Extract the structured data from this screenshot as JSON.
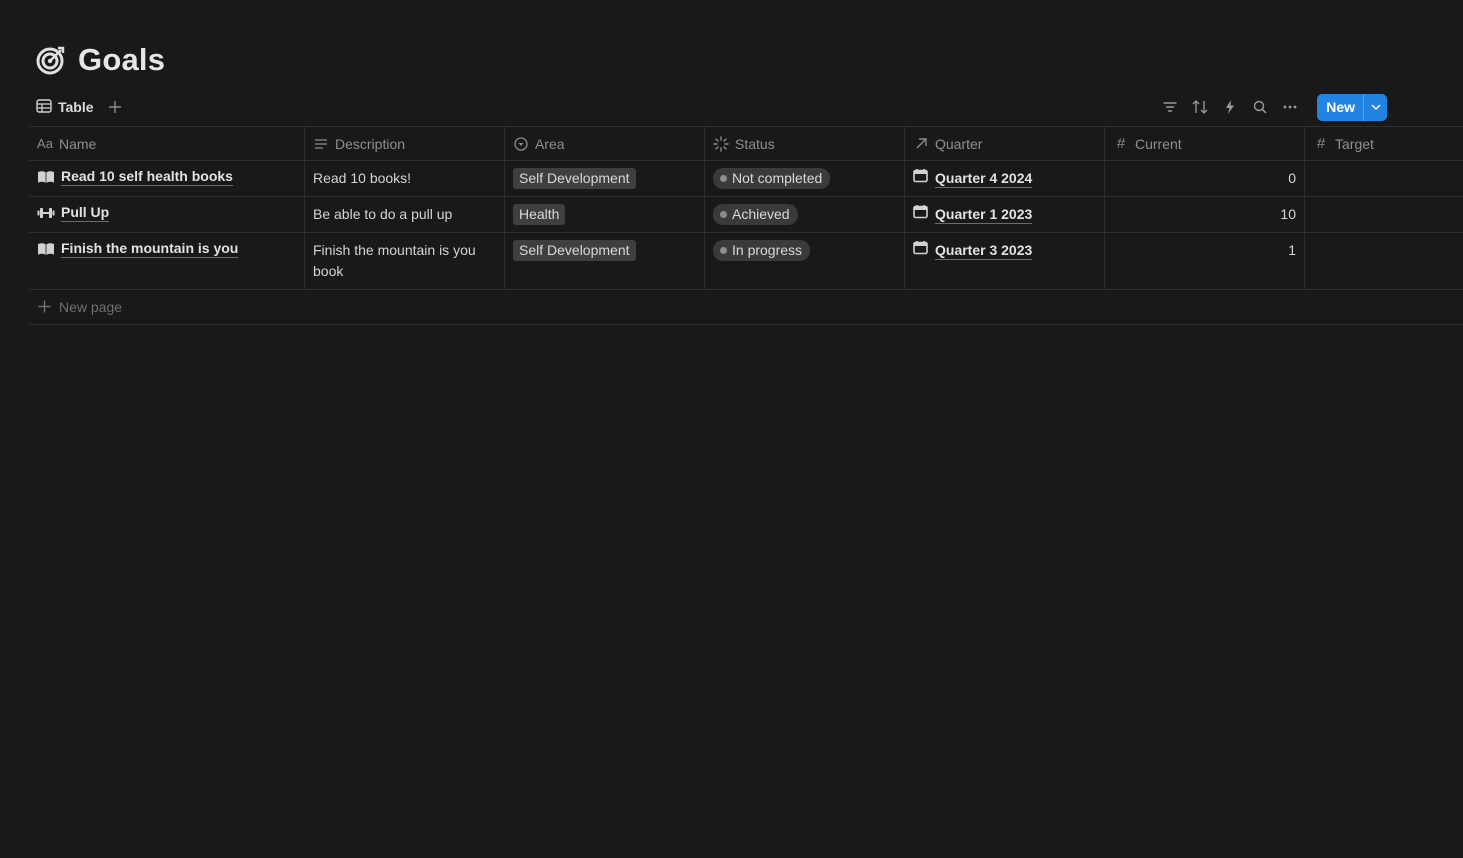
{
  "page": {
    "title": "Goals",
    "icon": "target-icon"
  },
  "view": {
    "tabs": [
      {
        "label": "Table",
        "icon": "table-icon"
      }
    ],
    "new_button": {
      "label": "New"
    }
  },
  "columns": [
    {
      "label": "Name",
      "icon": "text-aa-icon"
    },
    {
      "label": "Description",
      "icon": "lines-icon"
    },
    {
      "label": "Area",
      "icon": "select-icon"
    },
    {
      "label": "Status",
      "icon": "status-spinner-icon"
    },
    {
      "label": "Quarter",
      "icon": "relation-arrow-icon"
    },
    {
      "label": "Current",
      "icon": "number-hash-icon"
    },
    {
      "label": "Target",
      "icon": "number-hash-icon"
    }
  ],
  "rows": [
    {
      "name": "Read 10 self health books",
      "icon": "book-icon",
      "description": "Read 10 books!",
      "area": "Self Development",
      "status": "Not completed",
      "quarter": "Quarter 4 2024",
      "current": "0",
      "target": ""
    },
    {
      "name": "Pull Up",
      "icon": "dumbbell-icon",
      "description": "Be able to do a pull up",
      "area": "Health",
      "status": "Achieved",
      "quarter": "Quarter 1 2023",
      "current": "10",
      "target": ""
    },
    {
      "name": "Finish the mountain is you",
      "icon": "book-icon",
      "description": "Finish the mountain is you book",
      "area": "Self Development",
      "status": "In progress",
      "quarter": "Quarter 3 2023",
      "current": "1",
      "target": ""
    }
  ],
  "footer": {
    "new_page_label": "New page"
  },
  "colors": {
    "background": "#191919",
    "accent": "#2383e2",
    "tag_bg": "#3f3f3f",
    "border": "#2f2f2f"
  }
}
